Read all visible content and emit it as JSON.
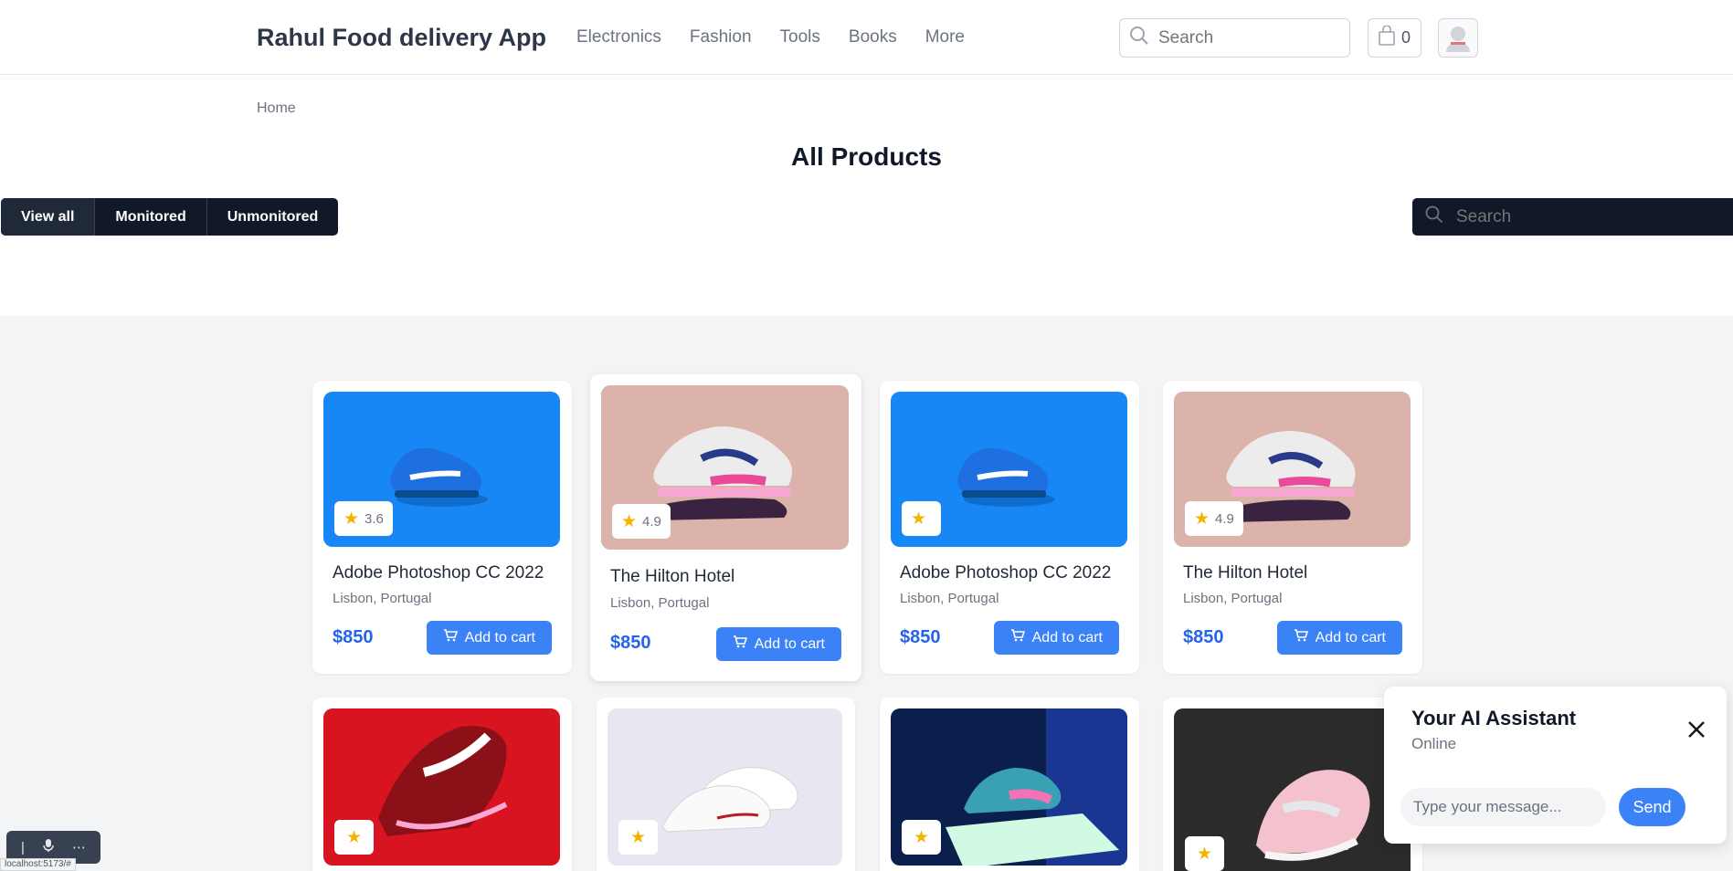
{
  "header": {
    "brand": "Rahul Food delivery App",
    "nav": [
      "Electronics",
      "Fashion",
      "Tools",
      "Books",
      "More"
    ],
    "search_placeholder": "Search",
    "cart_count": "0"
  },
  "breadcrumb": "Home",
  "page_title": "All Products",
  "filters": [
    "View all",
    "Monitored",
    "Unmonitored"
  ],
  "active_filter": "View all",
  "product_search_placeholder": "Search",
  "products": [
    {
      "name": "Adobe Photoshop CC 2022",
      "location": "Lisbon, Portugal",
      "price": "$850",
      "rating": "3.6",
      "button": "Add to cart",
      "image": "blue-sneaker"
    },
    {
      "name": "The Hilton Hotel",
      "location": "Lisbon, Portugal",
      "price": "$850",
      "rating": "4.9",
      "button": "Add to cart",
      "image": "pink-sneaker"
    },
    {
      "name": "Adobe Photoshop CC 2022",
      "location": "Lisbon, Portugal",
      "price": "$850",
      "rating": "",
      "button": "Add to cart",
      "image": "blue-sneaker"
    },
    {
      "name": "The Hilton Hotel",
      "location": "Lisbon, Portugal",
      "price": "$850",
      "rating": "4.9",
      "button": "Add to cart",
      "image": "pink-sneaker"
    },
    {
      "name": "",
      "location": "",
      "price": "",
      "rating": "",
      "button": "",
      "image": "red-sneaker"
    },
    {
      "name": "",
      "location": "",
      "price": "",
      "rating": "",
      "button": "",
      "image": "white-sneaker"
    },
    {
      "name": "",
      "location": "",
      "price": "",
      "rating": "",
      "button": "",
      "image": "teal-sneaker"
    },
    {
      "name": "",
      "location": "",
      "price": "",
      "rating": "",
      "button": "",
      "image": "grey-pink-sneaker"
    }
  ],
  "assistant": {
    "title": "Your AI Assistant",
    "status": "Online",
    "input_placeholder": "Type your message...",
    "send_label": "Send"
  },
  "status_url": "localhost:5173/#",
  "colors": {
    "accent": "#3b82f6",
    "dark": "#111827",
    "price": "#2563eb",
    "star": "#f5b301"
  }
}
